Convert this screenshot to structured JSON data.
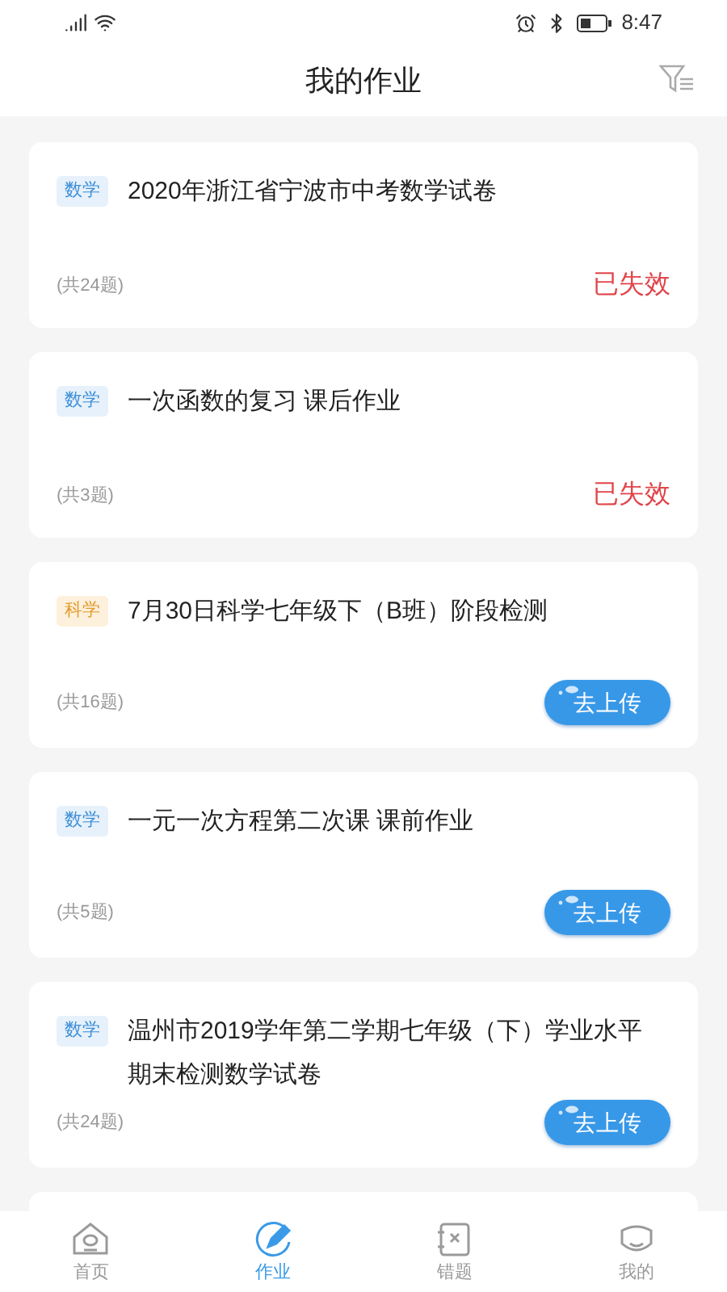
{
  "status_bar": {
    "time": "8:47"
  },
  "header": {
    "title": "我的作业"
  },
  "assignments": [
    {
      "subject": {
        "label": "数学",
        "kind": "math"
      },
      "title": "2020年浙江省宁波市中考数学试卷",
      "count": "(共24题)",
      "action": {
        "kind": "expired",
        "label": "已失效"
      }
    },
    {
      "subject": {
        "label": "数学",
        "kind": "math"
      },
      "title": "一次函数的复习 课后作业",
      "count": "(共3题)",
      "action": {
        "kind": "expired",
        "label": "已失效"
      }
    },
    {
      "subject": {
        "label": "科学",
        "kind": "science"
      },
      "title": "7月30日科学七年级下（B班）阶段检测",
      "count": "(共16题)",
      "action": {
        "kind": "upload",
        "label": "去上传"
      }
    },
    {
      "subject": {
        "label": "数学",
        "kind": "math"
      },
      "title": "一元一次方程第二次课 课前作业",
      "count": "(共5题)",
      "action": {
        "kind": "upload",
        "label": "去上传"
      }
    },
    {
      "subject": {
        "label": "数学",
        "kind": "math"
      },
      "title": "温州市2019学年第二学期七年级（下）学业水平期末检测数学试卷",
      "count": "(共24题)",
      "action": {
        "kind": "upload",
        "label": "去上传"
      }
    }
  ],
  "tab_bar": [
    {
      "label": "首页",
      "kind": "home",
      "selected": false
    },
    {
      "label": "作业",
      "kind": "homework",
      "selected": true
    },
    {
      "label": "错题",
      "kind": "mistakes",
      "selected": false
    },
    {
      "label": "我的",
      "kind": "me",
      "selected": false
    }
  ]
}
